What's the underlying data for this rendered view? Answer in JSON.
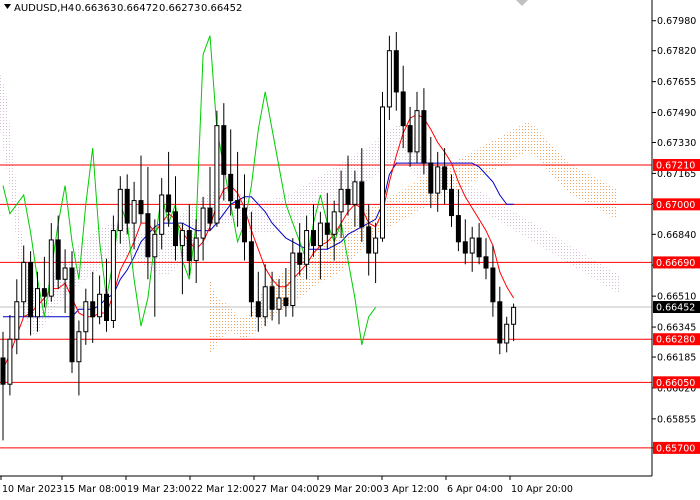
{
  "chart_data": {
    "type": "candlestick",
    "header": {
      "symbol_label": "AUDUSD,H4",
      "open": "0.66363",
      "high": "0.66472",
      "low": "0.66273",
      "close": "0.66452"
    },
    "ylim": [
      0.6555,
      0.6808
    ],
    "y_ticks": [
      "0.67980",
      "0.67820",
      "0.67655",
      "0.67490",
      "0.67330",
      "0.67165",
      "0.67005",
      "0.66840",
      "0.66675",
      "0.66510",
      "0.66345",
      "0.66185",
      "0.66020",
      "0.65855",
      "0.65700"
    ],
    "x_ticks": [
      "10 Mar 2023",
      "15 Mar 08:00",
      "19 Mar 23:00",
      "22 Mar 12:00",
      "27 Mar 04:00",
      "29 Mar 20:00",
      "3 Apr 12:00",
      "6 Apr 04:00",
      "10 Apr 20:00"
    ],
    "levels": [
      {
        "label": "0.67210",
        "value": 0.6721
      },
      {
        "label": "0.67000",
        "value": 0.67
      },
      {
        "label": "0.66690",
        "value": 0.6669
      },
      {
        "label": "0.66280",
        "value": 0.6628
      },
      {
        "label": "0.66050",
        "value": 0.6605
      },
      {
        "label": "0.65700",
        "value": 0.657
      }
    ],
    "current_price": {
      "label": "0.66452",
      "value": 0.66452
    },
    "candles": [
      [
        0.6618,
        0.6632,
        0.6574,
        0.6604
      ],
      [
        0.6604,
        0.6641,
        0.6598,
        0.6628
      ],
      [
        0.6628,
        0.666,
        0.662,
        0.6648
      ],
      [
        0.6648,
        0.6678,
        0.664,
        0.6669
      ],
      [
        0.6669,
        0.6675,
        0.663,
        0.664
      ],
      [
        0.664,
        0.6664,
        0.6632,
        0.6655
      ],
      [
        0.6655,
        0.6672,
        0.6645,
        0.6651
      ],
      [
        0.6651,
        0.669,
        0.6648,
        0.6681
      ],
      [
        0.6681,
        0.6694,
        0.6655,
        0.666
      ],
      [
        0.666,
        0.6676,
        0.6642,
        0.6666
      ],
      [
        0.6666,
        0.6675,
        0.661,
        0.6616
      ],
      [
        0.6616,
        0.6638,
        0.6598,
        0.6632
      ],
      [
        0.6632,
        0.6655,
        0.6625,
        0.6648
      ],
      [
        0.6648,
        0.6664,
        0.6626,
        0.664
      ],
      [
        0.664,
        0.6662,
        0.6636,
        0.6652
      ],
      [
        0.6652,
        0.6671,
        0.6632,
        0.6638
      ],
      [
        0.6638,
        0.6694,
        0.6634,
        0.6686
      ],
      [
        0.6686,
        0.6715,
        0.6679,
        0.6708
      ],
      [
        0.6708,
        0.6716,
        0.6684,
        0.669
      ],
      [
        0.669,
        0.6712,
        0.6676,
        0.6702
      ],
      [
        0.6702,
        0.6726,
        0.669,
        0.6695
      ],
      [
        0.6695,
        0.672,
        0.666,
        0.6672
      ],
      [
        0.6672,
        0.6692,
        0.664,
        0.6684
      ],
      [
        0.6684,
        0.6714,
        0.6676,
        0.6705
      ],
      [
        0.6705,
        0.6728,
        0.6688,
        0.6696
      ],
      [
        0.6696,
        0.6715,
        0.667,
        0.6678
      ],
      [
        0.6678,
        0.669,
        0.6652,
        0.6686
      ],
      [
        0.6686,
        0.67,
        0.6662,
        0.667
      ],
      [
        0.667,
        0.6692,
        0.6658,
        0.6682
      ],
      [
        0.6682,
        0.6704,
        0.667,
        0.6698
      ],
      [
        0.6698,
        0.672,
        0.6686,
        0.669
      ],
      [
        0.669,
        0.675,
        0.6688,
        0.6742
      ],
      [
        0.6742,
        0.6754,
        0.6702,
        0.6716
      ],
      [
        0.6716,
        0.674,
        0.6694,
        0.6702
      ],
      [
        0.6702,
        0.6728,
        0.6688,
        0.6698
      ],
      [
        0.6698,
        0.6716,
        0.667,
        0.668
      ],
      [
        0.668,
        0.6696,
        0.664,
        0.6648
      ],
      [
        0.6648,
        0.6664,
        0.6632,
        0.664
      ],
      [
        0.664,
        0.6668,
        0.6635,
        0.6656
      ],
      [
        0.6656,
        0.6664,
        0.6638,
        0.6644
      ],
      [
        0.6644,
        0.666,
        0.6636,
        0.665
      ],
      [
        0.665,
        0.6666,
        0.664,
        0.6646
      ],
      [
        0.6646,
        0.6682,
        0.664,
        0.6674
      ],
      [
        0.6674,
        0.669,
        0.6662,
        0.6668
      ],
      [
        0.6668,
        0.6694,
        0.666,
        0.6686
      ],
      [
        0.6686,
        0.67,
        0.6672,
        0.6678
      ],
      [
        0.6678,
        0.6696,
        0.666,
        0.669
      ],
      [
        0.669,
        0.6706,
        0.6676,
        0.6684
      ],
      [
        0.6684,
        0.6702,
        0.667,
        0.6696
      ],
      [
        0.6696,
        0.6718,
        0.6682,
        0.6708
      ],
      [
        0.6708,
        0.6726,
        0.6694,
        0.67
      ],
      [
        0.67,
        0.6718,
        0.6688,
        0.6712
      ],
      [
        0.6712,
        0.673,
        0.668,
        0.6688
      ],
      [
        0.6688,
        0.67,
        0.6662,
        0.6674
      ],
      [
        0.6674,
        0.669,
        0.6658,
        0.6682
      ],
      [
        0.6682,
        0.676,
        0.668,
        0.6752
      ],
      [
        0.6752,
        0.679,
        0.6745,
        0.6782
      ],
      [
        0.6782,
        0.6792,
        0.675,
        0.676
      ],
      [
        0.676,
        0.6774,
        0.673,
        0.6742
      ],
      [
        0.6742,
        0.6752,
        0.672,
        0.6728
      ],
      [
        0.6728,
        0.676,
        0.6722,
        0.675
      ],
      [
        0.675,
        0.6762,
        0.6716,
        0.6722
      ],
      [
        0.6722,
        0.6736,
        0.6698,
        0.6706
      ],
      [
        0.6706,
        0.6728,
        0.6696,
        0.672
      ],
      [
        0.672,
        0.673,
        0.67,
        0.6708
      ],
      [
        0.6708,
        0.6716,
        0.6688,
        0.6694
      ],
      [
        0.6694,
        0.6708,
        0.6675,
        0.668
      ],
      [
        0.668,
        0.6692,
        0.6668,
        0.6674
      ],
      [
        0.6674,
        0.6688,
        0.6664,
        0.6682
      ],
      [
        0.6682,
        0.669,
        0.6668,
        0.6672
      ],
      [
        0.6672,
        0.6682,
        0.666,
        0.6666
      ],
      [
        0.6666,
        0.6678,
        0.664,
        0.6648
      ],
      [
        0.6648,
        0.6656,
        0.662,
        0.6626
      ],
      [
        0.6626,
        0.664,
        0.6621,
        0.6636
      ],
      [
        0.6636,
        0.6647,
        0.6627,
        0.6645
      ]
    ],
    "tenkan_red": [
      0.6612,
      0.662,
      0.663,
      0.664,
      0.6642,
      0.6646,
      0.665,
      0.6655,
      0.6655,
      0.6658,
      0.665,
      0.6642,
      0.664,
      0.664,
      0.6642,
      0.6642,
      0.6652,
      0.6665,
      0.6672,
      0.668,
      0.669,
      0.669,
      0.6685,
      0.669,
      0.6695,
      0.6692,
      0.6685,
      0.668,
      0.6676,
      0.668,
      0.6688,
      0.67,
      0.6708,
      0.671,
      0.6706,
      0.6698,
      0.6686,
      0.6676,
      0.6666,
      0.666,
      0.6656,
      0.6656,
      0.666,
      0.6664,
      0.6668,
      0.6674,
      0.6678,
      0.668,
      0.6684,
      0.669,
      0.6696,
      0.67,
      0.6698,
      0.669,
      0.6688,
      0.6696,
      0.6712,
      0.6726,
      0.6738,
      0.6746,
      0.6748,
      0.6746,
      0.674,
      0.6733,
      0.6728,
      0.6722,
      0.6712,
      0.6704,
      0.6698,
      0.6692,
      0.6686,
      0.6678,
      0.6664,
      0.6656,
      0.665
    ],
    "kijun_blue": [
      0.664,
      0.664,
      0.664,
      0.664,
      0.664,
      0.664,
      0.664,
      0.664,
      0.664,
      0.664,
      0.664,
      0.6644,
      0.6644,
      0.6644,
      0.6646,
      0.665,
      0.6652,
      0.666,
      0.6665,
      0.6672,
      0.668,
      0.6684,
      0.6688,
      0.669,
      0.669,
      0.669,
      0.669,
      0.6688,
      0.6686,
      0.6686,
      0.6686,
      0.669,
      0.6695,
      0.67,
      0.6702,
      0.6704,
      0.6704,
      0.67,
      0.6696,
      0.669,
      0.6686,
      0.6682,
      0.668,
      0.6678,
      0.6676,
      0.6676,
      0.6676,
      0.6676,
      0.6678,
      0.668,
      0.6684,
      0.6686,
      0.6688,
      0.669,
      0.6692,
      0.67,
      0.6716,
      0.6722,
      0.6722,
      0.6722,
      0.6722,
      0.6722,
      0.6722,
      0.6722,
      0.6722,
      0.6722,
      0.6722,
      0.6722,
      0.6722,
      0.672,
      0.6716,
      0.6712,
      0.6705,
      0.67,
      0.67
    ],
    "chikou_green": [
      0.671,
      0.6695,
      0.67,
      0.6705,
      0.6685,
      0.666,
      0.664,
      0.6665,
      0.669,
      0.671,
      0.668,
      0.666,
      0.67,
      0.673,
      0.668,
      0.665,
      0.667,
      0.67,
      0.669,
      0.666,
      0.6635,
      0.665,
      0.668,
      0.6705,
      0.669,
      0.67,
      0.667,
      0.666,
      0.669,
      0.678,
      0.679,
      0.674,
      0.672,
      0.67,
      0.668,
      0.669,
      0.671,
      0.674,
      0.676,
      0.674,
      0.672,
      0.67,
      0.669,
      0.668,
      0.667,
      0.669,
      0.6705,
      0.669,
      0.668,
      0.669,
      0.667,
      0.665,
      0.6625,
      0.664,
      0.6645
    ],
    "cloud_pink": [
      [
        0.677,
        0.674
      ],
      [
        0.676,
        0.672
      ],
      [
        0.673,
        0.67
      ],
      [
        0.67,
        0.667
      ],
      [
        0.667,
        0.664
      ],
      [
        0.666,
        0.663
      ],
      [
        0.665,
        0.663
      ],
      [
        0.665,
        0.6635
      ],
      [
        0.666,
        0.664
      ],
      [
        0.6665,
        0.6645
      ],
      [
        0.6668,
        0.6648
      ],
      [
        0.667,
        0.6652
      ],
      [
        0.6675,
        0.6655
      ],
      [
        0.668,
        0.6658
      ],
      [
        0.6682,
        0.666
      ],
      [
        0.6685,
        0.6662
      ],
      [
        0.6688,
        0.6665
      ],
      [
        0.6688,
        0.6668
      ],
      [
        0.669,
        0.667
      ],
      [
        0.669,
        0.667
      ],
      [
        0.669,
        0.6672
      ],
      [
        0.6688,
        0.6672
      ],
      [
        0.6686,
        0.667
      ],
      [
        0.6685,
        0.6668
      ],
      [
        0.6684,
        0.6666
      ],
      [
        0.6684,
        0.6664
      ],
      [
        0.6684,
        0.6662
      ],
      [
        0.6685,
        0.6662
      ],
      [
        0.669,
        0.6664
      ],
      [
        0.6694,
        0.6668
      ],
      [
        0.6698,
        0.6672
      ],
      [
        0.67,
        0.6676
      ],
      [
        0.6702,
        0.668
      ],
      [
        0.6704,
        0.6684
      ],
      [
        0.6706,
        0.6686
      ],
      [
        0.6708,
        0.669
      ],
      [
        0.6708,
        0.669
      ],
      [
        0.6707,
        0.669
      ],
      [
        0.6706,
        0.6688
      ],
      [
        0.6705,
        0.6686
      ],
      [
        0.6704,
        0.6685
      ],
      [
        0.6703,
        0.6684
      ],
      [
        0.6702,
        0.6684
      ],
      [
        0.6702,
        0.6684
      ],
      [
        0.6703,
        0.6685
      ],
      [
        0.6704,
        0.6686
      ],
      [
        0.6705,
        0.6688
      ],
      [
        0.6706,
        0.669
      ],
      [
        0.6708,
        0.669
      ],
      [
        0.671,
        0.6692
      ],
      [
        0.6712,
        0.6694
      ],
      [
        0.6714,
        0.6696
      ],
      [
        0.6716,
        0.6698
      ],
      [
        0.6718,
        0.67
      ],
      [
        0.672,
        0.67
      ],
      [
        0.6722,
        0.6702
      ],
      [
        0.6724,
        0.6705
      ],
      [
        0.6726,
        0.6708
      ],
      [
        0.6728,
        0.671
      ],
      [
        0.673,
        0.6712
      ],
      [
        0.6732,
        0.6714
      ],
      [
        0.6735,
        0.6716
      ],
      [
        0.6738,
        0.6718
      ],
      [
        0.674,
        0.672
      ],
      [
        0.6742,
        0.6722
      ],
      [
        0.6744,
        0.6724
      ],
      [
        0.674,
        0.672
      ],
      [
        0.6735,
        0.6715
      ],
      [
        0.673,
        0.6712
      ],
      [
        0.6725,
        0.671
      ],
      [
        0.6722,
        0.671
      ],
      [
        0.672,
        0.6708
      ],
      [
        0.6718,
        0.6706
      ],
      [
        0.6716,
        0.6705
      ],
      [
        0.6714,
        0.6704
      ],
      [
        0.6712,
        0.6703
      ],
      [
        0.671,
        0.67
      ],
      [
        0.6708,
        0.6698
      ],
      [
        0.6706,
        0.6696
      ],
      [
        0.6704,
        0.6694
      ],
      [
        0.6702,
        0.6692
      ],
      [
        0.67,
        0.669
      ],
      [
        0.6698,
        0.6688
      ],
      [
        0.6696,
        0.6686
      ],
      [
        0.6694,
        0.6684
      ],
      [
        0.6692,
        0.6682
      ],
      [
        0.669,
        0.668
      ],
      [
        0.6688,
        0.6678
      ],
      [
        0.6686,
        0.6676
      ],
      [
        0.6684,
        0.6674
      ],
      [
        0.6682,
        0.6672
      ],
      [
        0.668,
        0.667
      ],
      [
        0.6678,
        0.6668
      ],
      [
        0.6676,
        0.6666
      ],
      [
        0.6674,
        0.6664
      ],
      [
        0.6672,
        0.6662
      ],
      [
        0.667,
        0.666
      ],
      [
        0.6668,
        0.6658
      ],
      [
        0.6666,
        0.6656
      ],
      [
        0.6664,
        0.6654
      ],
      [
        0.6662,
        0.6652
      ]
    ],
    "cloud_orange": [
      [
        0.666,
        0.662
      ],
      [
        0.665,
        0.6625
      ],
      [
        0.6648,
        0.663
      ],
      [
        0.6645,
        0.6632
      ],
      [
        0.664,
        0.663
      ],
      [
        0.664,
        0.6628
      ],
      [
        0.6642,
        0.663
      ],
      [
        0.665,
        0.6632
      ],
      [
        0.6655,
        0.6636
      ],
      [
        0.666,
        0.664
      ],
      [
        0.6662,
        0.6642
      ],
      [
        0.6665,
        0.6645
      ],
      [
        0.6668,
        0.6648
      ],
      [
        0.667,
        0.665
      ],
      [
        0.6673,
        0.6653
      ],
      [
        0.6676,
        0.6656
      ],
      [
        0.668,
        0.6658
      ],
      [
        0.6683,
        0.666
      ],
      [
        0.6686,
        0.6662
      ],
      [
        0.669,
        0.6664
      ],
      [
        0.6692,
        0.6668
      ],
      [
        0.6694,
        0.6672
      ],
      [
        0.6696,
        0.6676
      ],
      [
        0.6698,
        0.668
      ],
      [
        0.67,
        0.6684
      ],
      [
        0.6702,
        0.6686
      ],
      [
        0.6704,
        0.6688
      ],
      [
        0.6706,
        0.669
      ],
      [
        0.6708,
        0.6692
      ],
      [
        0.671,
        0.6694
      ],
      [
        0.6712,
        0.6696
      ],
      [
        0.6714,
        0.6698
      ],
      [
        0.6716,
        0.67
      ],
      [
        0.6718,
        0.6702
      ],
      [
        0.672,
        0.6704
      ],
      [
        0.6722,
        0.6706
      ],
      [
        0.6724,
        0.6708
      ],
      [
        0.6726,
        0.671
      ],
      [
        0.6728,
        0.6712
      ],
      [
        0.673,
        0.6714
      ],
      [
        0.6732,
        0.6716
      ],
      [
        0.6734,
        0.6718
      ],
      [
        0.6736,
        0.672
      ],
      [
        0.6738,
        0.6722
      ],
      [
        0.674,
        0.6724
      ],
      [
        0.6742,
        0.6726
      ],
      [
        0.6744,
        0.6728
      ],
      [
        0.6742,
        0.6726
      ],
      [
        0.6738,
        0.6722
      ],
      [
        0.6734,
        0.6718
      ],
      [
        0.673,
        0.6714
      ],
      [
        0.6726,
        0.671
      ],
      [
        0.6722,
        0.6706
      ],
      [
        0.672,
        0.6704
      ],
      [
        0.6718,
        0.6702
      ],
      [
        0.6716,
        0.67
      ],
      [
        0.6714,
        0.6698
      ],
      [
        0.6712,
        0.6696
      ],
      [
        0.671,
        0.6694
      ],
      [
        0.6708,
        0.6692
      ]
    ],
    "colors": {
      "background": "#ffffff",
      "candle": "#000000",
      "levels": "#ff0000",
      "tenkan": "#ff0000",
      "kijun": "#0000cc",
      "chikou": "#00cc00",
      "cloud_up": "#f4a460",
      "cloud_down": "#d8bfd8",
      "label_bg": "#ff0000",
      "label_text": "#ffffff",
      "price_bg": "#000000"
    },
    "grid": false
  }
}
